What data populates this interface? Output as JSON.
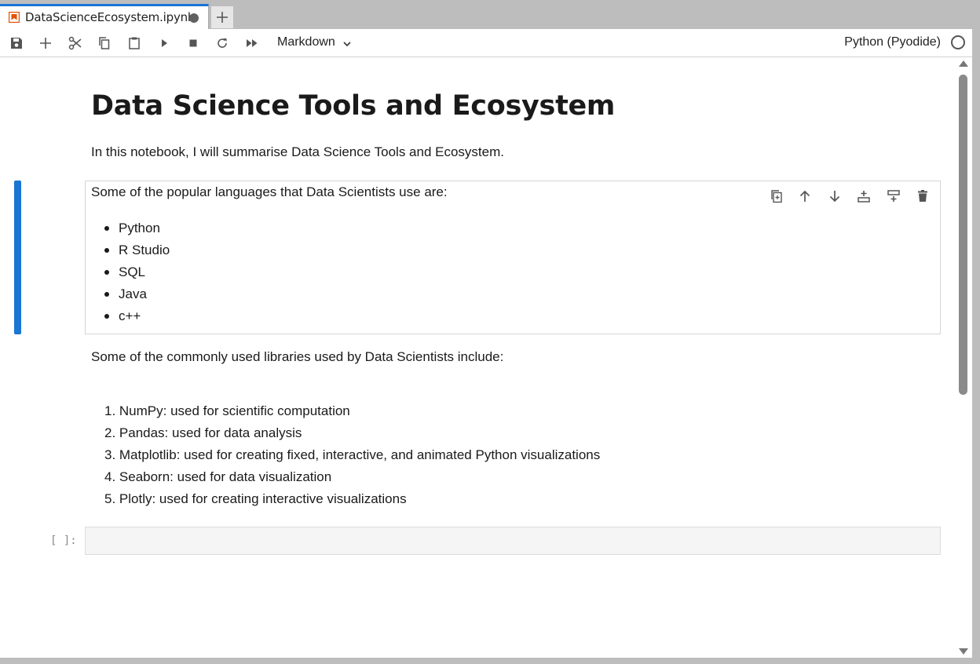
{
  "tab": {
    "title": "DataScienceEcosystem.ipynb",
    "icon": "notebook-icon",
    "unsaved_indicator": "dot",
    "accent": "#1a73d8"
  },
  "toolbar": {
    "buttons": [
      "save-icon",
      "add-cell-icon",
      "cut-icon",
      "copy-icon",
      "paste-icon",
      "run-icon",
      "stop-icon",
      "restart-icon",
      "run-all-icon"
    ],
    "cell_type": "Markdown",
    "kernel_name": "Python (Pyodide)",
    "kernel_status": "idle"
  },
  "notebook": {
    "title": "Data Science Tools and Ecosystem",
    "intro": "In this notebook, I will summarise Data Science Tools and Ecosystem.",
    "languages_heading": "Some of the popular languages that Data Scientists use are:",
    "languages": [
      "Python",
      "R Studio",
      "SQL",
      "Java",
      "c++"
    ],
    "libraries_heading": "Some of the commonly used libraries used by Data Scientists include:",
    "libraries": [
      "1. NumPy: used for scientific computation",
      "2. Pandas: used for data analysis",
      "3. Matplotlib: used for creating fixed, interactive, and animated Python visualizations",
      "4. Seaborn: used for data visualization",
      "5. Plotly: used for creating interactive visualizations"
    ],
    "code_prompt": "[ ]:",
    "cell_actions": [
      "duplicate-icon",
      "move-up-icon",
      "move-down-icon",
      "insert-above-icon",
      "insert-below-icon",
      "delete-icon"
    ],
    "active_color": "#1976d2"
  }
}
